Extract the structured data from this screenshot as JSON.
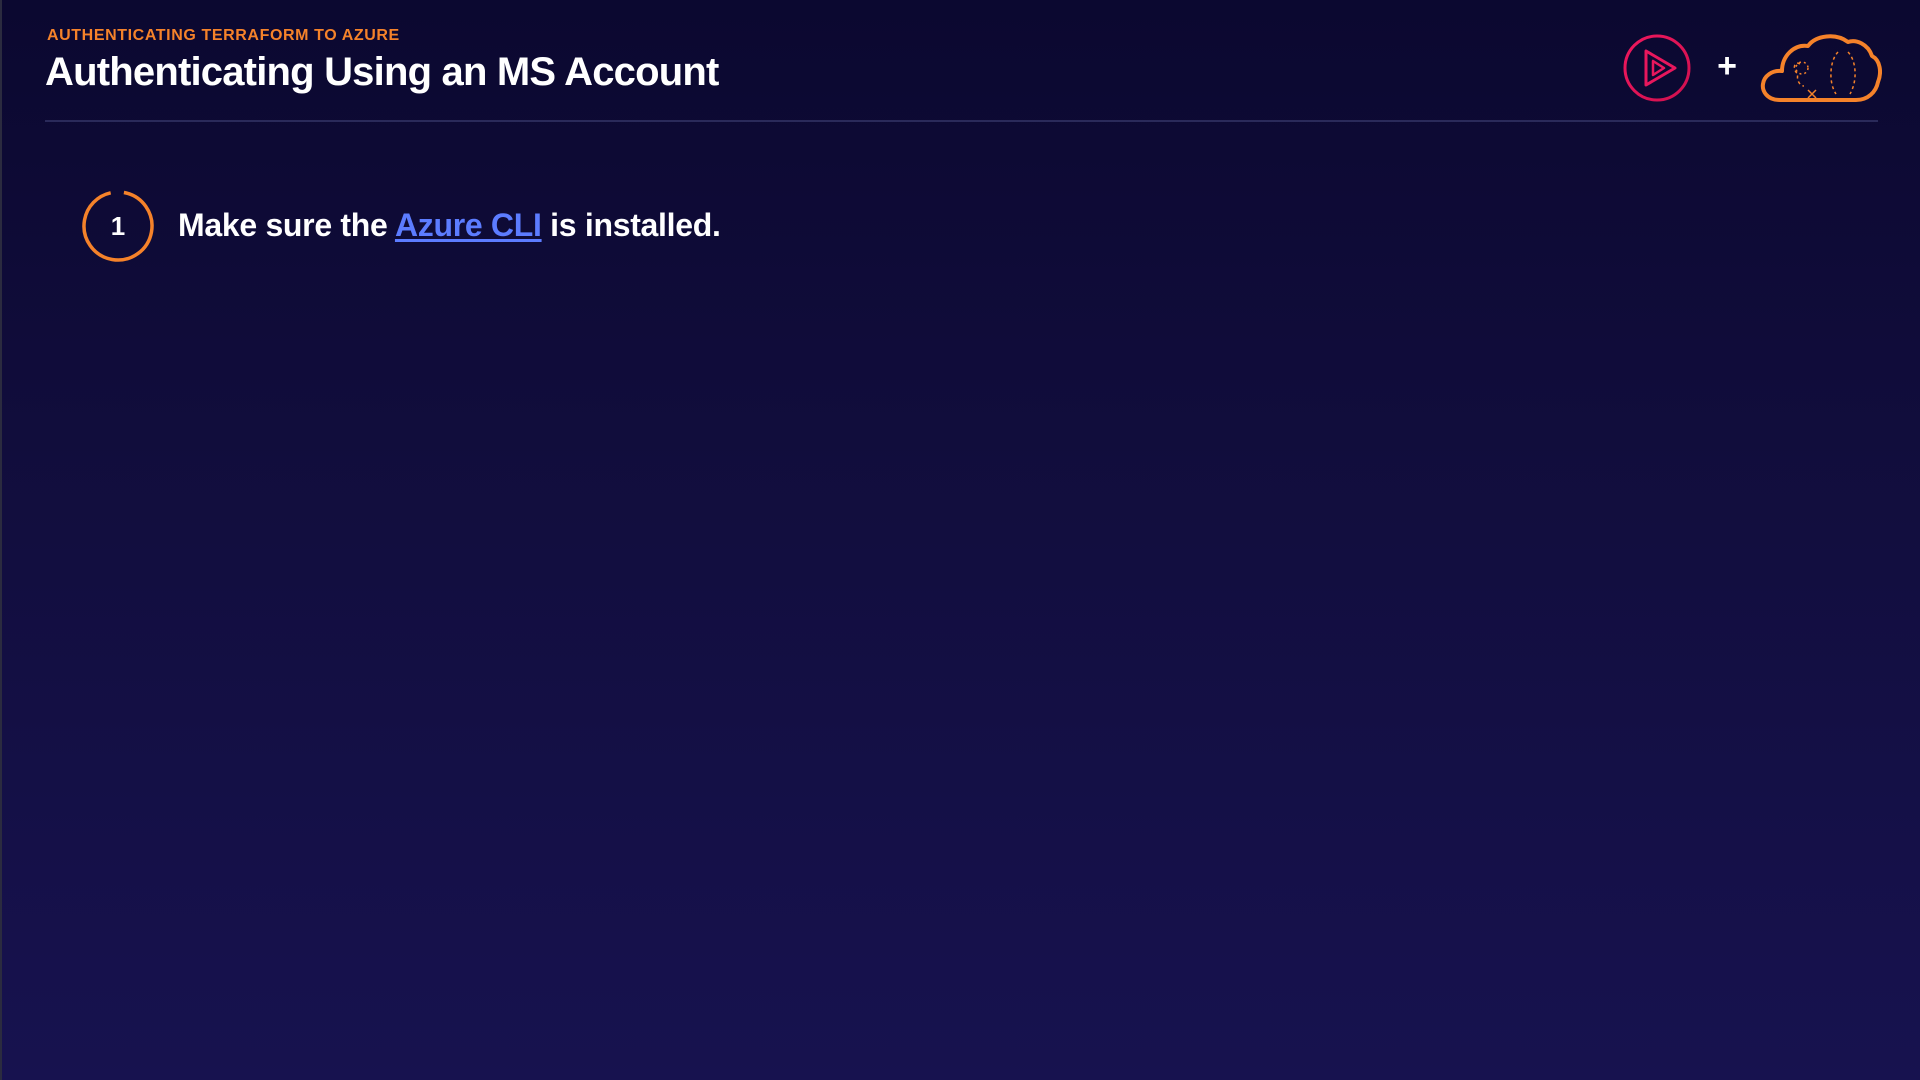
{
  "header": {
    "eyebrow": "AUTHENTICATING TERRAFORM TO AZURE",
    "title": "Authenticating Using an MS Account"
  },
  "logos": {
    "play_icon": "pluralsight-play-icon",
    "plus": "+",
    "cloud_icon": "cloud-icon"
  },
  "step": {
    "number": "1",
    "text_before": "Make sure the ",
    "link_text": "Azure CLI",
    "text_after": " is installed."
  },
  "colors": {
    "accent_orange": "#f5822a",
    "play_pink": "#e8175d",
    "link_blue": "#5c7cff",
    "background_top": "#0b0830",
    "background_bottom": "#17124f"
  }
}
